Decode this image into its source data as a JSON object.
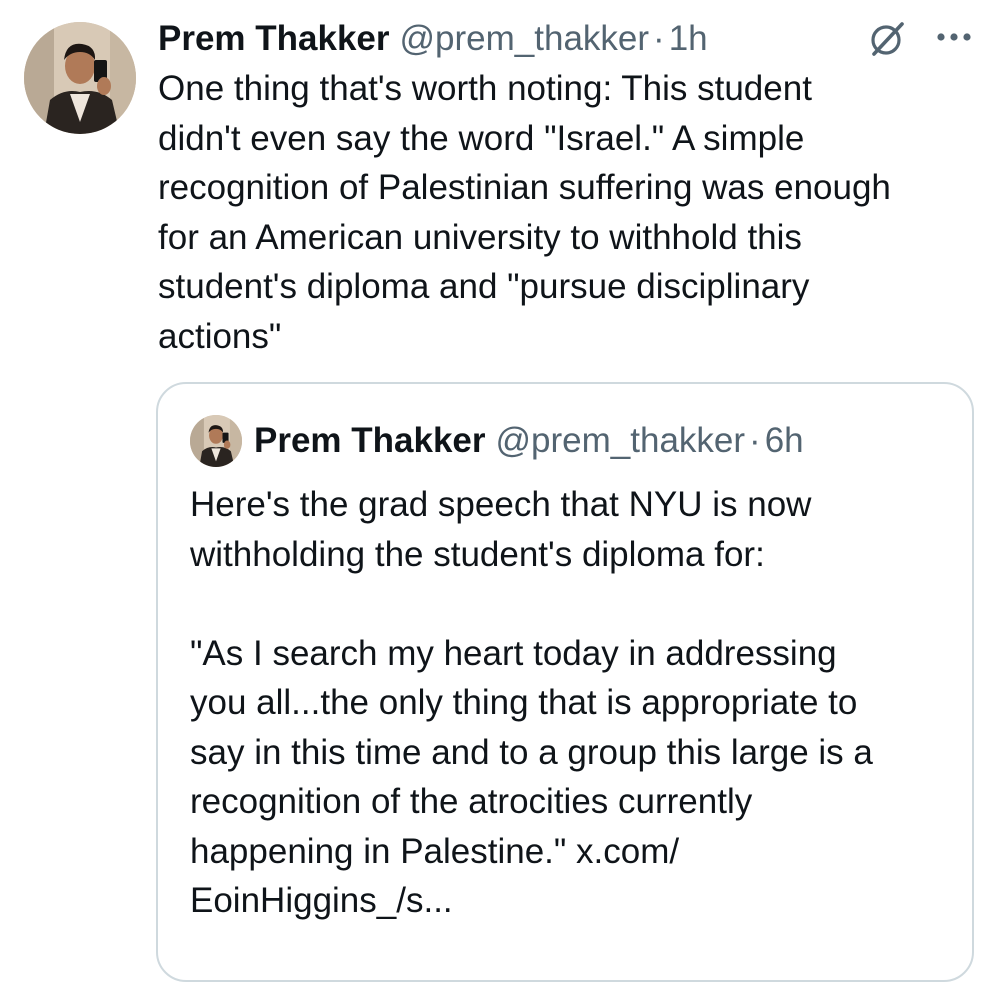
{
  "tweet": {
    "author_name": "Prem Thakker",
    "author_handle": "@prem_thakker",
    "separator": "·",
    "time": "1h",
    "body_lines": [
      "One thing that's worth noting: This student",
      "didn't even say the word \"Israel.\" A simple",
      "recognition of Palestinian suffering was enough",
      "for an American university to withhold this",
      "student's diploma and \"pursue disciplinary",
      "actions\""
    ],
    "icons": {
      "grok": "grok-icon",
      "more": "more-options-icon",
      "avatar": "avatar"
    }
  },
  "quoted_tweet": {
    "author_name": "Prem Thakker",
    "author_handle": "@prem_thakker",
    "separator": "·",
    "time": "6h",
    "body_lines": [
      "Here's the grad speech that NYU is now",
      "withholding the student's diploma for:",
      "",
      "\"As I search my heart today in addressing",
      "you all...the only thing that is appropriate to",
      "say in this time and to a group this large is a",
      "recognition of the atrocities currently",
      "happening in Palestine.\" x.com/",
      "EoinHiggins_/s..."
    ]
  },
  "colors": {
    "text_primary": "#0f1419",
    "text_secondary": "#536471",
    "border": "#cfd9de",
    "background": "#ffffff"
  }
}
